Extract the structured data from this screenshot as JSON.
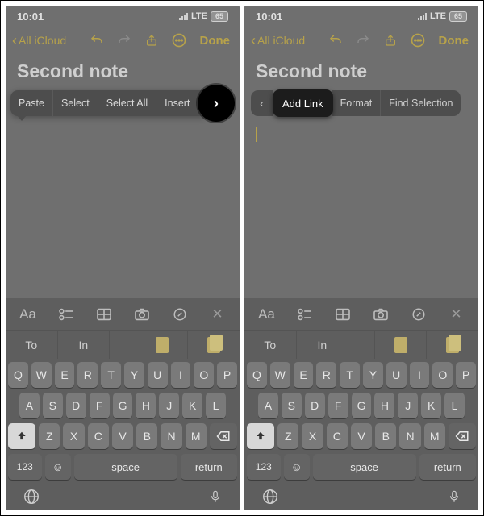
{
  "status": {
    "time": "10:01",
    "network": "LTE",
    "battery": "65"
  },
  "nav": {
    "back_label": "All iCloud",
    "done_label": "Done"
  },
  "note": {
    "title": "Second note"
  },
  "edit_menu_page1": {
    "paste": "Paste",
    "select": "Select",
    "select_all": "Select All",
    "insert": "Insert"
  },
  "edit_menu_page2": {
    "add_link": "Add Link",
    "format": "Format",
    "find_selection": "Find Selection"
  },
  "predictive": {
    "left": "To",
    "center": "In"
  },
  "keyboard": {
    "space": "space",
    "return": "return",
    "numbers": "123",
    "row1": [
      "Q",
      "W",
      "E",
      "R",
      "T",
      "Y",
      "U",
      "I",
      "O",
      "P"
    ],
    "row2": [
      "A",
      "S",
      "D",
      "F",
      "G",
      "H",
      "J",
      "K",
      "L"
    ],
    "row3": [
      "Z",
      "X",
      "C",
      "V",
      "B",
      "N",
      "M"
    ]
  },
  "toolbar_icons": [
    "text-format",
    "checklist",
    "table",
    "camera",
    "markup",
    "close"
  ]
}
